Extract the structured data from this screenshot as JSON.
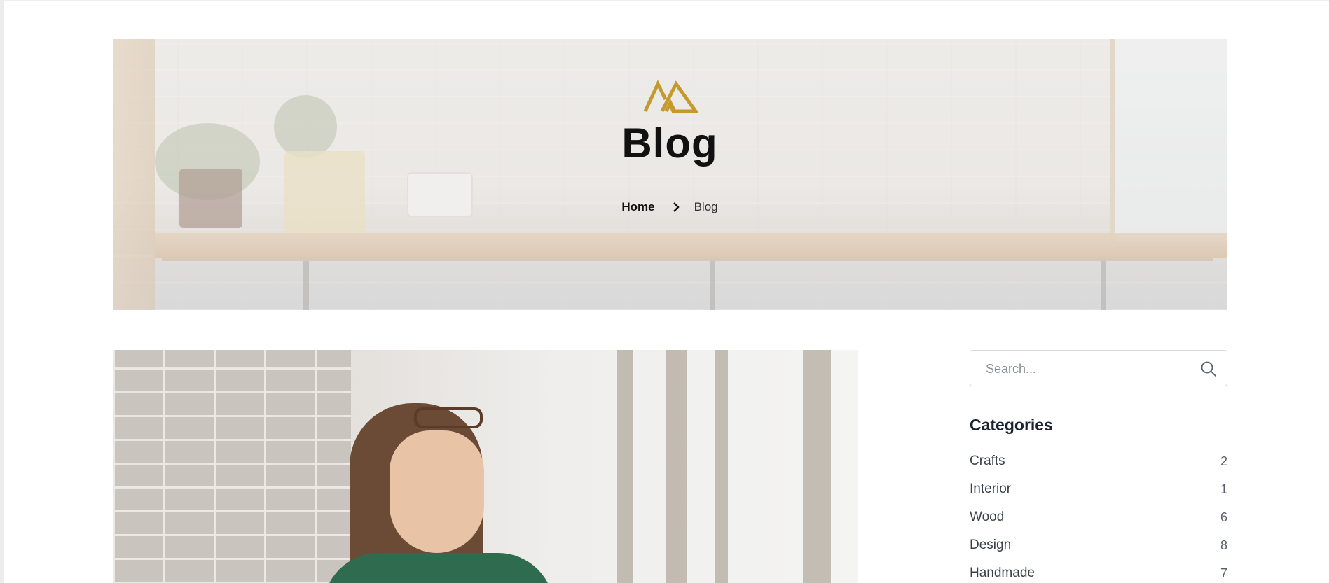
{
  "hero": {
    "title": "Blog",
    "breadcrumb": {
      "home": "Home",
      "current": "Blog"
    },
    "logo_color": "#c49a2c"
  },
  "search": {
    "placeholder": "Search...",
    "value": ""
  },
  "categories": {
    "title": "Categories",
    "items": [
      {
        "label": "Crafts",
        "count": "2"
      },
      {
        "label": "Interior",
        "count": "1"
      },
      {
        "label": "Wood",
        "count": "6"
      },
      {
        "label": "Design",
        "count": "8"
      },
      {
        "label": "Handmade",
        "count": "7"
      }
    ]
  },
  "icons": {
    "logo": "brand-logo-icon",
    "breadcrumb_separator": "chevron-right-icon",
    "search": "search-icon"
  }
}
